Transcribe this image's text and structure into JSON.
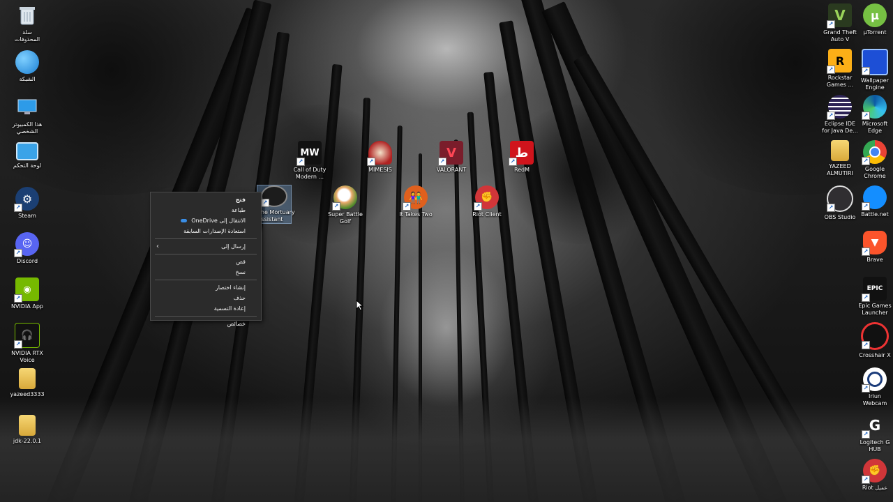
{
  "desktop": {
    "left_icons": [
      {
        "label": "سلة\nالمحذوفات",
        "icon": "recycle-bin-icon"
      },
      {
        "label": "الشبكة",
        "icon": "network-icon"
      },
      {
        "label": "هذا الكمبيوتر\nالشخصي",
        "icon": "this-pc-icon"
      },
      {
        "label": "لوحة التحكم",
        "icon": "control-panel-icon"
      },
      {
        "label": "Steam",
        "icon": "steam-icon"
      },
      {
        "label": "Discord",
        "icon": "discord-icon"
      },
      {
        "label": "NVIDIA App",
        "icon": "nvidia-icon"
      },
      {
        "label": "NVIDIA RTX\nVoice",
        "icon": "nvidia-rtx-voice-icon"
      },
      {
        "label": "yazeed3333",
        "icon": "zip-folder-icon"
      },
      {
        "label": "jdk-22.0.1",
        "icon": "zip-folder-icon"
      }
    ],
    "right_col1": [
      {
        "label": "Grand Theft\nAuto V",
        "icon": "gta-v-icon"
      },
      {
        "label": "Rockstar\nGames ...",
        "icon": "rockstar-icon"
      },
      {
        "label": "Eclipse IDE\nfor Java De...",
        "icon": "eclipse-icon"
      },
      {
        "label": "YAZEED\nALMUTIRI",
        "icon": "user-folder-icon"
      },
      {
        "label": "OBS Studio",
        "icon": "obs-icon"
      }
    ],
    "right_col2": [
      {
        "label": "µTorrent",
        "icon": "utorrent-icon"
      },
      {
        "label": "Wallpaper\nEngine",
        "icon": "wallpaper-engine-icon"
      },
      {
        "label": "Microsoft\nEdge",
        "icon": "edge-icon"
      },
      {
        "label": "Google\nChrome",
        "icon": "chrome-icon"
      },
      {
        "label": "Battle.net",
        "icon": "battlenet-icon"
      },
      {
        "label": "Brave",
        "icon": "brave-icon"
      },
      {
        "label": "Epic Games\nLauncher",
        "icon": "epic-games-icon"
      },
      {
        "label": "Crosshair X",
        "icon": "crosshair-icon"
      },
      {
        "label": "Iriun\nWebcam",
        "icon": "webcam-icon"
      },
      {
        "label": "Logitech G\nHUB",
        "icon": "logitech-icon"
      },
      {
        "label": "Riot عميل",
        "icon": "riot-icon"
      }
    ],
    "middle_icons": [
      {
        "label": "Call of Duty\nModern ...",
        "icon": "cod-mw-icon",
        "glyph": "MW"
      },
      {
        "label": "MIMESIS",
        "icon": "mimesis-icon",
        "glyph": ""
      },
      {
        "label": "VALORANT",
        "icon": "valorant-icon",
        "glyph": "V"
      },
      {
        "label": "RedM",
        "icon": "redm-icon",
        "glyph": "ط"
      },
      {
        "label": "The Mortuary\nAssistant",
        "icon": "mortuary-assistant-icon",
        "glyph": ""
      },
      {
        "label": "Super Battle\nGolf",
        "icon": "golf-icon",
        "glyph": ""
      },
      {
        "label": "It Takes Two",
        "icon": "it-takes-two-icon",
        "glyph": ""
      },
      {
        "label": "Riot Client",
        "icon": "riot-client-icon",
        "glyph": ""
      }
    ]
  },
  "context_menu": {
    "open": "فتح",
    "print": "طباعة",
    "move_onedrive": "الانتقال إلى OneDrive",
    "restore_versions": "استعادة الإصدارات السابقة",
    "send_to": "إرسال إلى",
    "cut": "قص",
    "copy": "نسخ",
    "create_shortcut": "إنشاء اختصار",
    "delete": "حذف",
    "rename": "إعادة التسمية",
    "properties": "خصائص"
  },
  "colors": {
    "menu_bg": "#2b2b2b",
    "menu_border": "#4a4a4a",
    "onedrive_blue": "#3a8ee6"
  }
}
